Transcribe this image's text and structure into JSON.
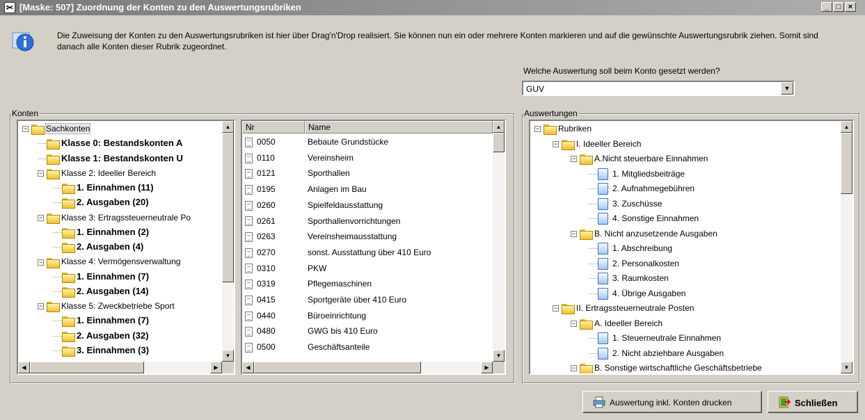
{
  "window": {
    "title": "[Maske: 507] Zuordnung der Konten zu den Auswertungsrubriken",
    "buttons": [
      "_",
      "□",
      "×"
    ]
  },
  "info": {
    "text": "Die Zuweisung der Konten zu den Auswertungsrubriken ist hier über Drag'n'Drop realisiert. Sie können nun ein oder mehrere Konten markieren und auf die gewünschte Auswertungsrubrik ziehen. Somit sind danach alle Konten dieser Rubrik zugeordnet."
  },
  "evaluation": {
    "label": "Welche Auswertung soll beim Konto gesetzt werden?",
    "selected": "GUV"
  },
  "konten": {
    "legend": "Konten",
    "tree": [
      {
        "label": "Sachkonten",
        "level": 0,
        "expander": "−",
        "bold": false,
        "selected": true
      },
      {
        "label": "Klasse 0: Bestandskonten A",
        "level": 1,
        "expander": "",
        "bold": true
      },
      {
        "label": "Klasse 1: Bestandskonten U",
        "level": 1,
        "expander": "",
        "bold": true
      },
      {
        "label": "Klasse 2: Ideeller Bereich",
        "level": 1,
        "expander": "−",
        "bold": false
      },
      {
        "label": "1. Einnahmen (11)",
        "level": 2,
        "expander": "",
        "bold": true
      },
      {
        "label": "2. Ausgaben (20)",
        "level": 2,
        "expander": "",
        "bold": true
      },
      {
        "label": "Klasse 3: Ertragssteuerneutrale Po",
        "level": 1,
        "expander": "−",
        "bold": false
      },
      {
        "label": "1. Einnahmen (2)",
        "level": 2,
        "expander": "",
        "bold": true
      },
      {
        "label": "2. Ausgaben (4)",
        "level": 2,
        "expander": "",
        "bold": true
      },
      {
        "label": "Klasse 4: Vermögensverwaltung",
        "level": 1,
        "expander": "−",
        "bold": false
      },
      {
        "label": "1. Einnahmen (7)",
        "level": 2,
        "expander": "",
        "bold": true
      },
      {
        "label": "2. Ausgaben (14)",
        "level": 2,
        "expander": "",
        "bold": true
      },
      {
        "label": "Klasse 5: Zweckbetriebe Sport",
        "level": 1,
        "expander": "−",
        "bold": false
      },
      {
        "label": "1. Einnahmen (7)",
        "level": 2,
        "expander": "",
        "bold": true
      },
      {
        "label": "2. Ausgaben (32)",
        "level": 2,
        "expander": "",
        "bold": true
      },
      {
        "label": "3. Einnahmen (3)",
        "level": 2,
        "expander": "",
        "bold": true
      }
    ]
  },
  "accounts": {
    "columns": [
      "Nr",
      "Name"
    ],
    "rows": [
      {
        "nr": "0050",
        "name": "Bebaute Grundstücke"
      },
      {
        "nr": "0110",
        "name": "Vereinsheim"
      },
      {
        "nr": "0121",
        "name": "Sporthallen"
      },
      {
        "nr": "0195",
        "name": "Anlagen im Bau"
      },
      {
        "nr": "0260",
        "name": "Spielfeldausstattung"
      },
      {
        "nr": "0261",
        "name": "Sporthallenvorrichtungen"
      },
      {
        "nr": "0263",
        "name": "Vereinsheimausstattung"
      },
      {
        "nr": "0270",
        "name": "sonst. Ausstattung über 410 Euro"
      },
      {
        "nr": "0310",
        "name": "PKW"
      },
      {
        "nr": "0319",
        "name": "Pflegemaschinen"
      },
      {
        "nr": "0415",
        "name": "Sportgeräte über 410 Euro"
      },
      {
        "nr": "0440",
        "name": "Büroeinrichtung"
      },
      {
        "nr": "0480",
        "name": "GWG bis 410 Euro"
      },
      {
        "nr": "0500",
        "name": "Geschäftsanteile"
      }
    ]
  },
  "auswertungen": {
    "legend": "Auswertungen",
    "tree": [
      {
        "label": "Rubriken",
        "level": 0,
        "expander": "−",
        "icon": "folder"
      },
      {
        "label": "I. Ideeller Bereich",
        "level": 1,
        "expander": "−",
        "icon": "folder"
      },
      {
        "label": "A.Nicht steuerbare Einnahmen",
        "level": 2,
        "expander": "−",
        "icon": "folder"
      },
      {
        "label": "1. Mitgliedsbeiträge",
        "level": 3,
        "expander": "",
        "icon": "doc"
      },
      {
        "label": "2. Aufnahmegebühren",
        "level": 3,
        "expander": "",
        "icon": "doc"
      },
      {
        "label": "3. Zuschüsse",
        "level": 3,
        "expander": "",
        "icon": "doc"
      },
      {
        "label": "4. Sonstige Einnahmen",
        "level": 3,
        "expander": "",
        "icon": "doc"
      },
      {
        "label": "B. Nicht anzusetzende Ausgaben",
        "level": 2,
        "expander": "−",
        "icon": "folder"
      },
      {
        "label": "1. Abschreibung",
        "level": 3,
        "expander": "",
        "icon": "doc"
      },
      {
        "label": "2. Personalkosten",
        "level": 3,
        "expander": "",
        "icon": "doc"
      },
      {
        "label": "3. Raumkosten",
        "level": 3,
        "expander": "",
        "icon": "doc"
      },
      {
        "label": "4. Übrige Ausgaben",
        "level": 3,
        "expander": "",
        "icon": "doc"
      },
      {
        "label": "II. Ertragssteuerneutrale Posten",
        "level": 1,
        "expander": "−",
        "icon": "folder"
      },
      {
        "label": "A. Ideeller Bereich",
        "level": 2,
        "expander": "−",
        "icon": "folder"
      },
      {
        "label": "1. Steuerneutrale Einnahmen",
        "level": 3,
        "expander": "",
        "icon": "doc"
      },
      {
        "label": "2. Nicht abziehbare Ausgaben",
        "level": 3,
        "expander": "",
        "icon": "doc"
      },
      {
        "label": "B. Sonstige wirtschaftliche Geschäftsbetriebe",
        "level": 2,
        "expander": "−",
        "icon": "folder"
      }
    ]
  },
  "footer": {
    "print_label": "Auswertung inkl. Konten drucken",
    "close_label": "Schließen"
  }
}
